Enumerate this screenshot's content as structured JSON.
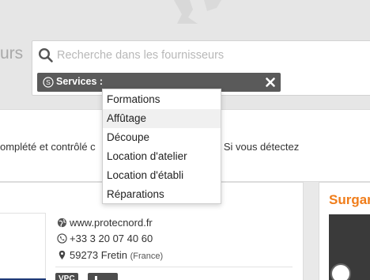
{
  "header": {
    "title_fragment": "urs"
  },
  "search": {
    "placeholder": "Recherche dans les fournisseurs",
    "filter_chip_label": "Services :"
  },
  "dropdown": {
    "items": [
      {
        "label": "Formations"
      },
      {
        "label": "Affûtage"
      },
      {
        "label": "Découpe"
      },
      {
        "label": "Location d'atelier"
      },
      {
        "label": "Location d'établi"
      },
      {
        "label": "Réparations"
      }
    ],
    "hovered_index": 1
  },
  "notice": {
    "text_left": "omplété et contrôlé c",
    "text_right": "munauté. Si vous détectez"
  },
  "supplier_card": {
    "website": "www.protecnord.fr",
    "phone": "+33 3 20 07 40 60",
    "postcode_city": "59273 Fretin",
    "country": "(France)",
    "tags": [
      "VPC"
    ]
  },
  "side_card": {
    "title_fragment": "Surgar"
  },
  "colors": {
    "accent_orange": "#f07d1a",
    "chip_bg": "#5a5a5a",
    "dropdown_hover": "#f0f0f0"
  },
  "icons": {
    "search": "search-icon",
    "chip": "circled-s-icon",
    "close": "close-icon",
    "globe": "globe-icon",
    "phone": "phone-icon",
    "location": "map-marker-icon"
  }
}
